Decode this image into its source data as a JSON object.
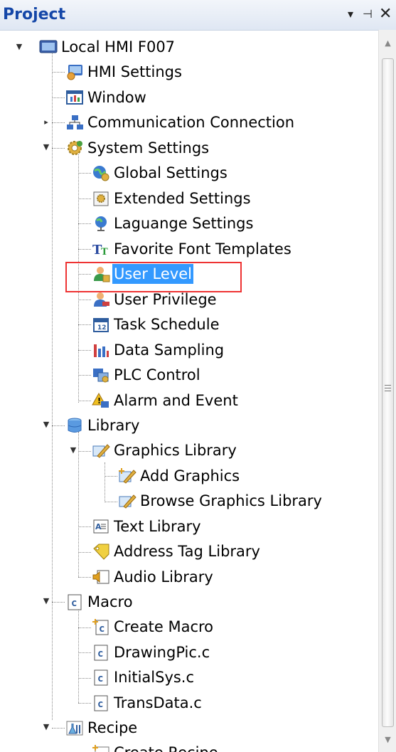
{
  "panel": {
    "title": "Project",
    "buttons": {
      "dropdown": "▾",
      "pin": "⊣",
      "close": "✕"
    }
  },
  "tree": {
    "root": "Local HMI F007",
    "hmi_settings": "HMI Settings",
    "window": "Window",
    "communication": "Communication Connection",
    "system_settings": {
      "label": "System Settings",
      "children": {
        "global": "Global Settings",
        "extended": "Extended Settings",
        "language": "Laguange Settings",
        "font_templates": "Favorite Font Templates",
        "user_level": "User Level",
        "user_privilege": "User Privilege",
        "task_schedule": "Task Schedule",
        "data_sampling": "Data Sampling",
        "plc_control": "PLC Control",
        "alarm_event": "Alarm and Event"
      }
    },
    "library": {
      "label": "Library",
      "graphics": {
        "label": "Graphics Library",
        "add": "Add Graphics",
        "browse": "Browse Graphics Library"
      },
      "text": "Text Library",
      "address_tag": "Address Tag Library",
      "audio": "Audio Library"
    },
    "macro": {
      "label": "Macro",
      "create": "Create Macro",
      "files": [
        "DrawingPic.c",
        "InitialSys.c",
        "TransData.c"
      ]
    },
    "recipe": {
      "label": "Recipe",
      "create": "Create Recipe"
    },
    "selected_item": "User Level"
  },
  "colors": {
    "header_title": "#1547a8",
    "selection": "#3399ff",
    "highlight_box": "#e33333"
  },
  "icons": {
    "expanded": "triangle-down",
    "collapsed": "triangle-right"
  }
}
